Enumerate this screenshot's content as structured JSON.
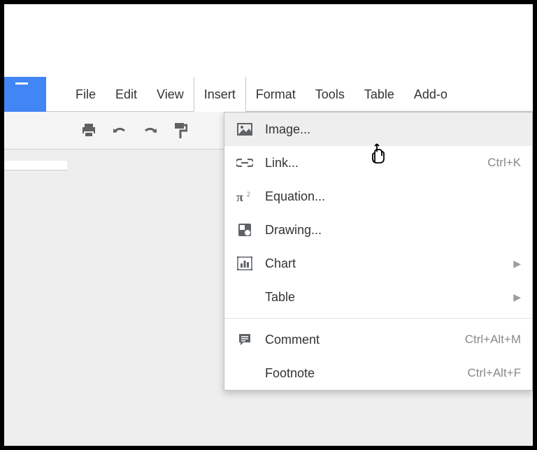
{
  "menubar": {
    "items": [
      "File",
      "Edit",
      "View",
      "Insert",
      "Format",
      "Tools",
      "Table",
      "Add-o"
    ],
    "active_index": 3
  },
  "dropdown": {
    "items": [
      {
        "icon": "image-icon",
        "label": "Image...",
        "shortcut": "",
        "submenu": false,
        "hover": true
      },
      {
        "icon": "link-icon",
        "label": "Link...",
        "shortcut": "Ctrl+K",
        "submenu": false
      },
      {
        "icon": "equation-icon",
        "label": "Equation...",
        "shortcut": "",
        "submenu": false
      },
      {
        "icon": "drawing-icon",
        "label": "Drawing...",
        "shortcut": "",
        "submenu": false
      },
      {
        "icon": "chart-icon",
        "label": "Chart",
        "shortcut": "",
        "submenu": true
      },
      {
        "icon": "",
        "label": "Table",
        "shortcut": "",
        "submenu": true
      },
      {
        "separator": true
      },
      {
        "icon": "comment-icon",
        "label": "Comment",
        "shortcut": "Ctrl+Alt+M",
        "submenu": false
      },
      {
        "icon": "",
        "label": "Footnote",
        "shortcut": "Ctrl+Alt+F",
        "submenu": false
      }
    ]
  }
}
